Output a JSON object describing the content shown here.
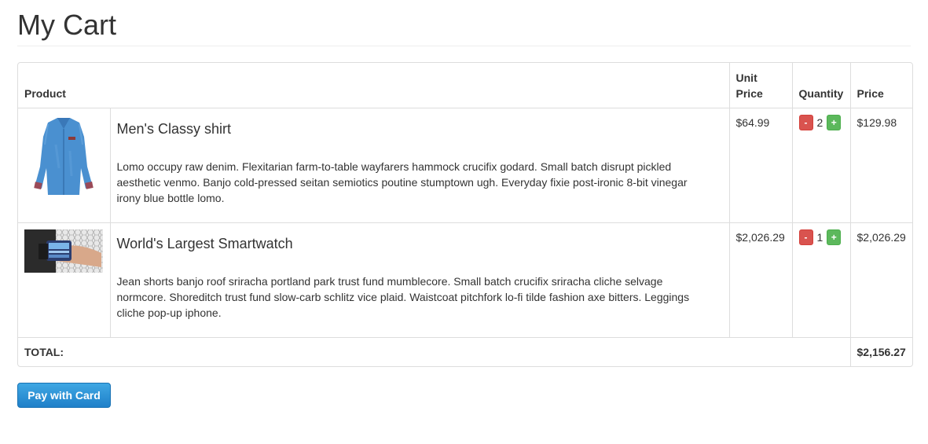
{
  "page": {
    "title": "My Cart"
  },
  "table": {
    "headers": {
      "product": "Product",
      "unit_price": "Unit Price",
      "quantity": "Quantity",
      "price": "Price"
    },
    "items": [
      {
        "image": "shirt-image",
        "name": "Men's Classy shirt",
        "description": "Lomo occupy raw denim. Flexitarian farm-to-table wayfarers hammock crucifix godard. Small batch disrupt pickled aesthetic venmo. Banjo cold-pressed seitan semiotics poutine stumptown ugh. Everyday fixie post-ironic 8-bit vinegar irony blue bottle lomo.",
        "unit_price": "$64.99",
        "quantity": "2",
        "price": "$129.98"
      },
      {
        "image": "smartwatch-image",
        "name": "World's Largest Smartwatch",
        "description": "Jean shorts banjo roof sriracha portland park trust fund mumblecore. Small batch crucifix sriracha cliche selvage normcore. Shoreditch trust fund slow-carb schlitz vice plaid. Waistcoat pitchfork lo-fi tilde fashion axe bitters. Leggings cliche pop-up iphone.",
        "unit_price": "$2,026.29",
        "quantity": "1",
        "price": "$2,026.29"
      }
    ],
    "minus_label": "-",
    "plus_label": "+",
    "total_label": "TOTAL:",
    "total_value": "$2,156.27"
  },
  "actions": {
    "pay_label": "Pay with Card"
  },
  "colors": {
    "minus": "#d9534f",
    "plus": "#5cb85c",
    "pay": "#2a8fd6"
  }
}
